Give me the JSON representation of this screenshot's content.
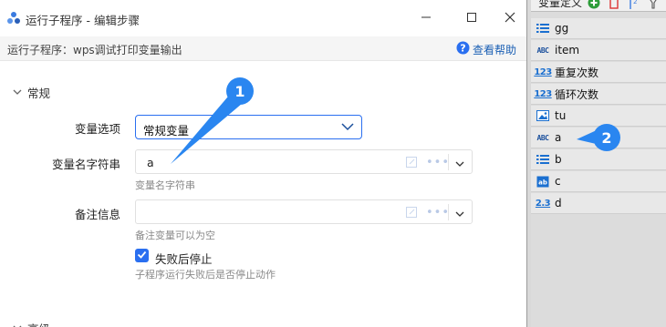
{
  "dialog": {
    "title": "运行子程序 - 编辑步骤",
    "subheader": "运行子程序：wps调试打印变量输出",
    "help_label": "查看帮助",
    "section_normal": "常规",
    "section_advanced": "高级",
    "fields": {
      "var_option": {
        "label": "变量选项",
        "value": "常规变量"
      },
      "var_name": {
        "label": "变量名字符串",
        "value": "a",
        "hint": "变量名字符串"
      },
      "remark": {
        "label": "备注信息",
        "value": "",
        "hint": "备注变量可以为空"
      },
      "stop_on_fail": {
        "label": "失败后停止",
        "checked": true,
        "hint": "子程序运行失败后是否停止动作"
      }
    }
  },
  "callouts": {
    "one": "1",
    "two": "2"
  },
  "var_panel": {
    "title": "变量定义",
    "items": [
      {
        "name": "gg",
        "icon": "list-icon"
      },
      {
        "name": "item",
        "icon": "abc-icon"
      },
      {
        "name": "重复次数",
        "icon": "number-icon"
      },
      {
        "name": "循环次数",
        "icon": "number-icon"
      },
      {
        "name": "tu",
        "icon": "image-icon"
      },
      {
        "name": "a",
        "icon": "abc-icon"
      },
      {
        "name": "b",
        "icon": "list-icon"
      },
      {
        "name": "c",
        "icon": "text-box-icon"
      },
      {
        "name": "d",
        "icon": "decimal-icon"
      }
    ]
  },
  "colors": {
    "accent": "#2a6ff0",
    "callout": "#2a86f0",
    "panel_bg": "#dcdcdc"
  }
}
